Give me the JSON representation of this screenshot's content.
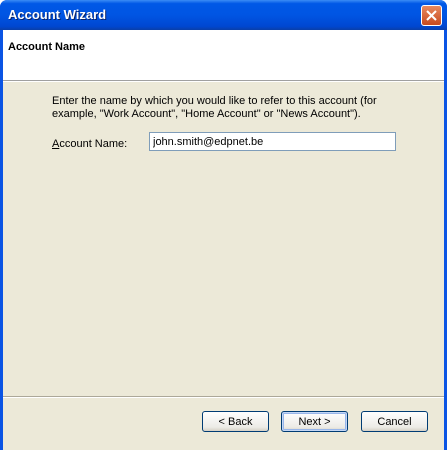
{
  "window": {
    "title": "Account Wizard"
  },
  "header": {
    "title": "Account Name"
  },
  "content": {
    "description": "Enter the name by which you would like to refer to this account (for example, \"Work Account\", \"Home Account\" or \"News Account\").",
    "field_label_accel": "A",
    "field_label_rest": "ccount Name:",
    "field_value": "john.smith@edpnet.be"
  },
  "buttons": {
    "back": "< Back",
    "next": "Next >",
    "cancel": "Cancel"
  },
  "icons": {
    "close": "close-icon"
  }
}
